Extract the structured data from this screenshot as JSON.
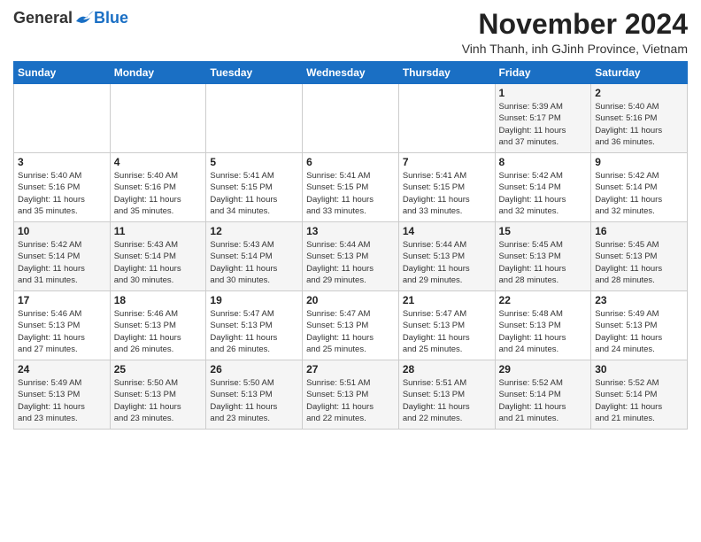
{
  "logo": {
    "general": "General",
    "blue": "Blue"
  },
  "title": {
    "month": "November 2024",
    "location": "Vinh Thanh, inh GJinh Province, Vietnam"
  },
  "headers": [
    "Sunday",
    "Monday",
    "Tuesday",
    "Wednesday",
    "Thursday",
    "Friday",
    "Saturday"
  ],
  "rows": [
    [
      {
        "day": "",
        "info": ""
      },
      {
        "day": "",
        "info": ""
      },
      {
        "day": "",
        "info": ""
      },
      {
        "day": "",
        "info": ""
      },
      {
        "day": "",
        "info": ""
      },
      {
        "day": "1",
        "info": "Sunrise: 5:39 AM\nSunset: 5:17 PM\nDaylight: 11 hours\nand 37 minutes."
      },
      {
        "day": "2",
        "info": "Sunrise: 5:40 AM\nSunset: 5:16 PM\nDaylight: 11 hours\nand 36 minutes."
      }
    ],
    [
      {
        "day": "3",
        "info": "Sunrise: 5:40 AM\nSunset: 5:16 PM\nDaylight: 11 hours\nand 35 minutes."
      },
      {
        "day": "4",
        "info": "Sunrise: 5:40 AM\nSunset: 5:16 PM\nDaylight: 11 hours\nand 35 minutes."
      },
      {
        "day": "5",
        "info": "Sunrise: 5:41 AM\nSunset: 5:15 PM\nDaylight: 11 hours\nand 34 minutes."
      },
      {
        "day": "6",
        "info": "Sunrise: 5:41 AM\nSunset: 5:15 PM\nDaylight: 11 hours\nand 33 minutes."
      },
      {
        "day": "7",
        "info": "Sunrise: 5:41 AM\nSunset: 5:15 PM\nDaylight: 11 hours\nand 33 minutes."
      },
      {
        "day": "8",
        "info": "Sunrise: 5:42 AM\nSunset: 5:14 PM\nDaylight: 11 hours\nand 32 minutes."
      },
      {
        "day": "9",
        "info": "Sunrise: 5:42 AM\nSunset: 5:14 PM\nDaylight: 11 hours\nand 32 minutes."
      }
    ],
    [
      {
        "day": "10",
        "info": "Sunrise: 5:42 AM\nSunset: 5:14 PM\nDaylight: 11 hours\nand 31 minutes."
      },
      {
        "day": "11",
        "info": "Sunrise: 5:43 AM\nSunset: 5:14 PM\nDaylight: 11 hours\nand 30 minutes."
      },
      {
        "day": "12",
        "info": "Sunrise: 5:43 AM\nSunset: 5:14 PM\nDaylight: 11 hours\nand 30 minutes."
      },
      {
        "day": "13",
        "info": "Sunrise: 5:44 AM\nSunset: 5:13 PM\nDaylight: 11 hours\nand 29 minutes."
      },
      {
        "day": "14",
        "info": "Sunrise: 5:44 AM\nSunset: 5:13 PM\nDaylight: 11 hours\nand 29 minutes."
      },
      {
        "day": "15",
        "info": "Sunrise: 5:45 AM\nSunset: 5:13 PM\nDaylight: 11 hours\nand 28 minutes."
      },
      {
        "day": "16",
        "info": "Sunrise: 5:45 AM\nSunset: 5:13 PM\nDaylight: 11 hours\nand 28 minutes."
      }
    ],
    [
      {
        "day": "17",
        "info": "Sunrise: 5:46 AM\nSunset: 5:13 PM\nDaylight: 11 hours\nand 27 minutes."
      },
      {
        "day": "18",
        "info": "Sunrise: 5:46 AM\nSunset: 5:13 PM\nDaylight: 11 hours\nand 26 minutes."
      },
      {
        "day": "19",
        "info": "Sunrise: 5:47 AM\nSunset: 5:13 PM\nDaylight: 11 hours\nand 26 minutes."
      },
      {
        "day": "20",
        "info": "Sunrise: 5:47 AM\nSunset: 5:13 PM\nDaylight: 11 hours\nand 25 minutes."
      },
      {
        "day": "21",
        "info": "Sunrise: 5:47 AM\nSunset: 5:13 PM\nDaylight: 11 hours\nand 25 minutes."
      },
      {
        "day": "22",
        "info": "Sunrise: 5:48 AM\nSunset: 5:13 PM\nDaylight: 11 hours\nand 24 minutes."
      },
      {
        "day": "23",
        "info": "Sunrise: 5:49 AM\nSunset: 5:13 PM\nDaylight: 11 hours\nand 24 minutes."
      }
    ],
    [
      {
        "day": "24",
        "info": "Sunrise: 5:49 AM\nSunset: 5:13 PM\nDaylight: 11 hours\nand 23 minutes."
      },
      {
        "day": "25",
        "info": "Sunrise: 5:50 AM\nSunset: 5:13 PM\nDaylight: 11 hours\nand 23 minutes."
      },
      {
        "day": "26",
        "info": "Sunrise: 5:50 AM\nSunset: 5:13 PM\nDaylight: 11 hours\nand 23 minutes."
      },
      {
        "day": "27",
        "info": "Sunrise: 5:51 AM\nSunset: 5:13 PM\nDaylight: 11 hours\nand 22 minutes."
      },
      {
        "day": "28",
        "info": "Sunrise: 5:51 AM\nSunset: 5:13 PM\nDaylight: 11 hours\nand 22 minutes."
      },
      {
        "day": "29",
        "info": "Sunrise: 5:52 AM\nSunset: 5:14 PM\nDaylight: 11 hours\nand 21 minutes."
      },
      {
        "day": "30",
        "info": "Sunrise: 5:52 AM\nSunset: 5:14 PM\nDaylight: 11 hours\nand 21 minutes."
      }
    ]
  ]
}
